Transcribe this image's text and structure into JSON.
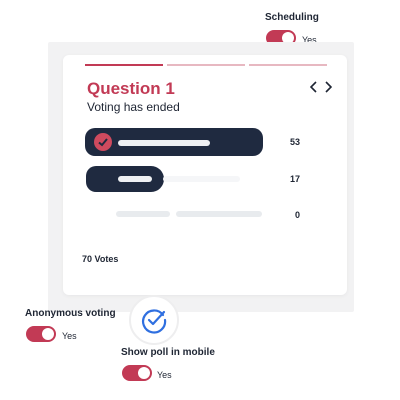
{
  "scheduling": {
    "label": "Scheduling",
    "value": "Yes",
    "enabled": true
  },
  "question": {
    "title": "Question 1",
    "status": "Voting has ended",
    "progress_steps": 3,
    "current_step": 1,
    "prev_icon": "chevron-left-icon",
    "next_icon": "chevron-right-icon"
  },
  "options": [
    {
      "votes": "53",
      "vote_fraction": 0.76,
      "selected": true
    },
    {
      "votes": "17",
      "vote_fraction": 0.24,
      "selected": false
    },
    {
      "votes": "0",
      "vote_fraction": 0.0,
      "selected": false
    }
  ],
  "total_votes": "70 Votes",
  "anonymous_voting": {
    "label": "Anonymous voting",
    "value": "Yes",
    "enabled": true
  },
  "show_poll_mobile": {
    "label": "Show poll in mobile",
    "value": "Yes",
    "enabled": true,
    "icon": "checkmark-circle-icon"
  },
  "colors": {
    "accent": "#c23a55",
    "bar_dark": "#1f2a40",
    "check_blue": "#2f6fe0"
  }
}
